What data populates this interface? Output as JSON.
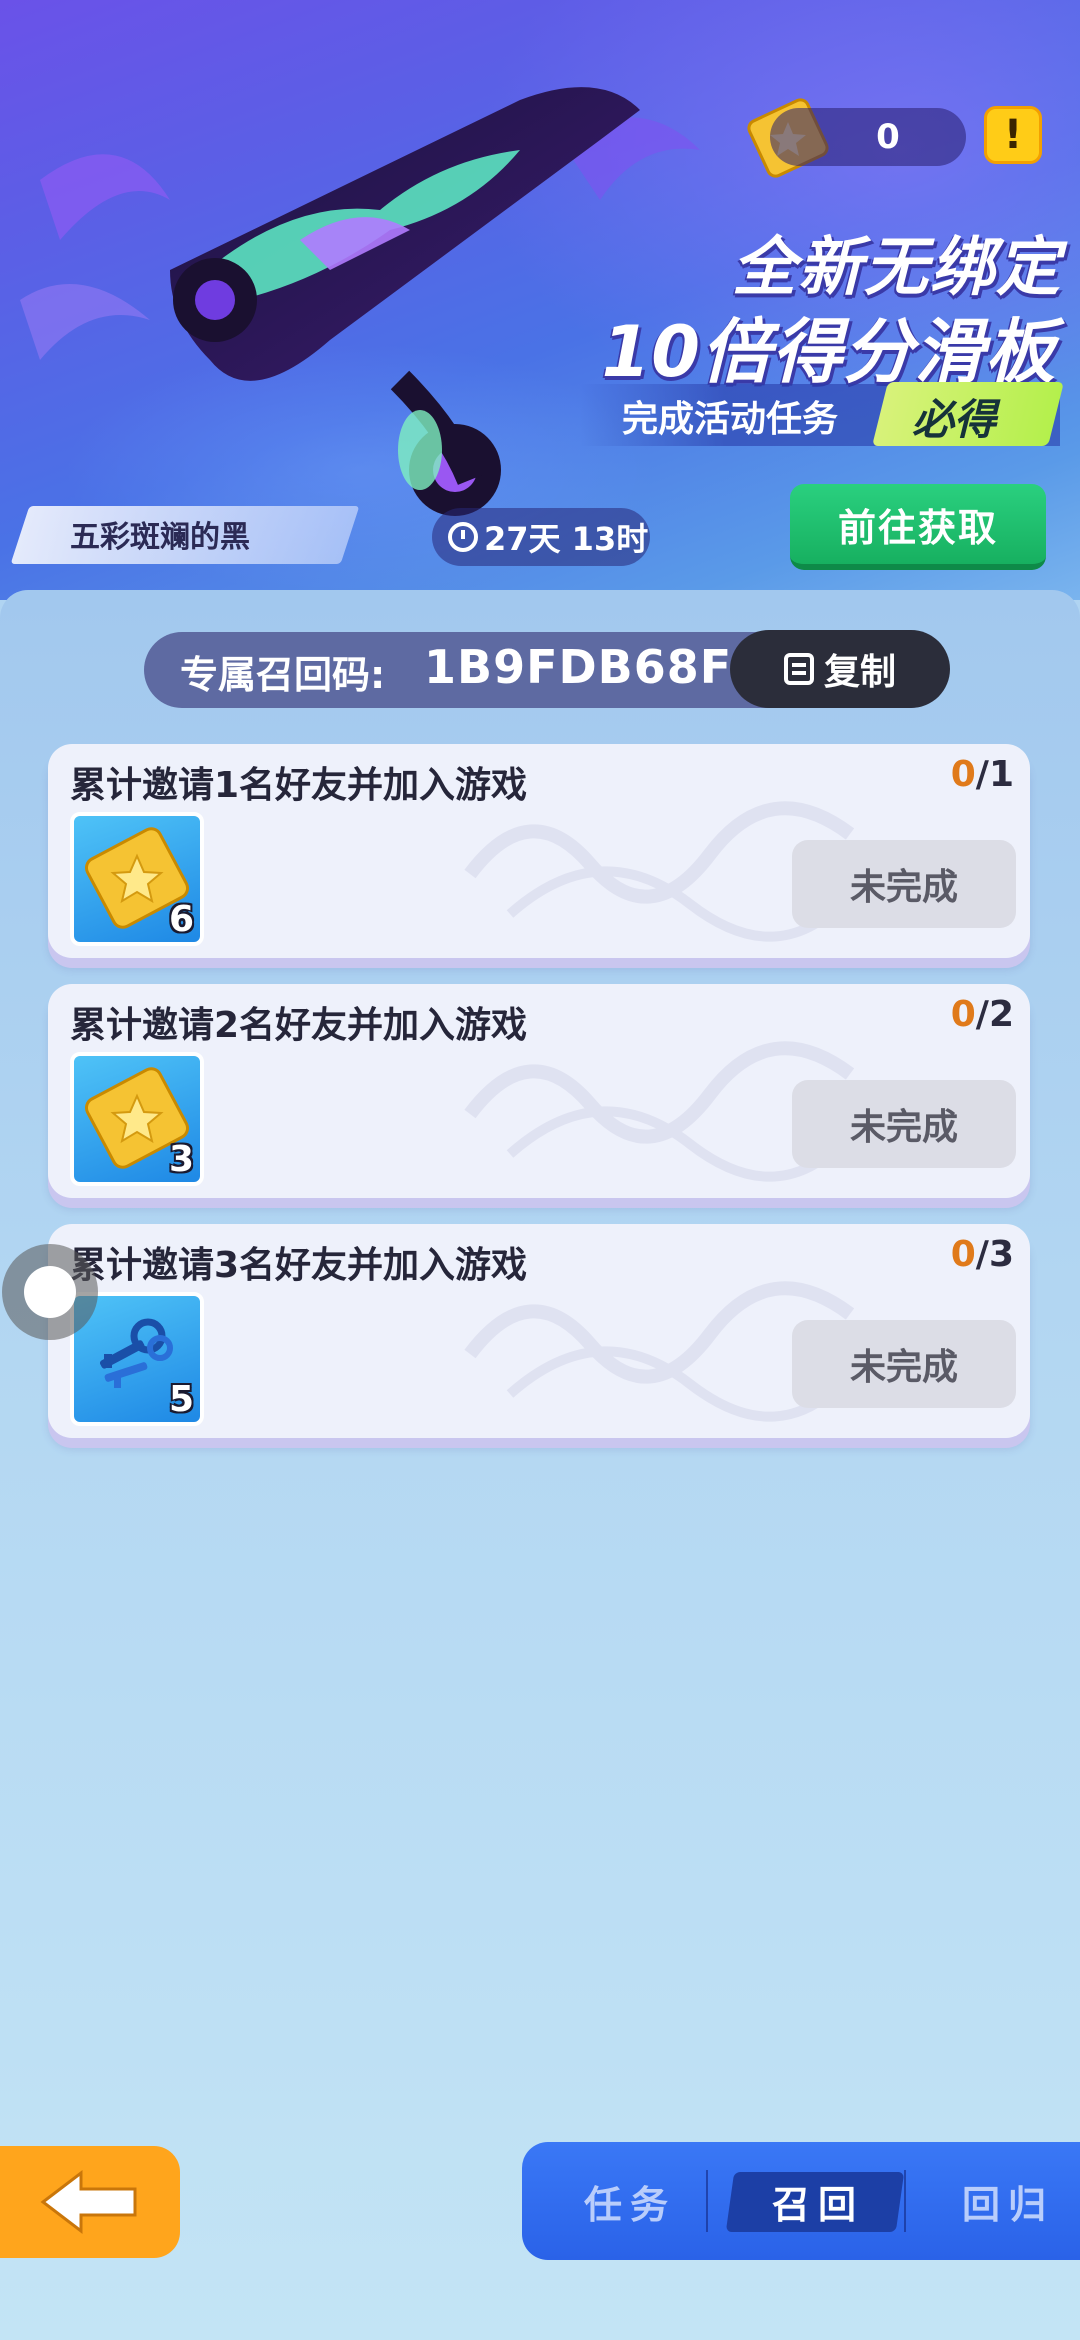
{
  "banner": {
    "currency_count": "0",
    "info_label": "!",
    "headline_line1": "全新无绑定",
    "headline_line2": "10倍得分滑板",
    "subtitle": "完成活动任务",
    "must_get": "必得",
    "skin_name": "五彩斑斓的黑",
    "countdown": "27天 13时",
    "goto_button": "前往获取"
  },
  "recall": {
    "label": "专属召回码:",
    "code": "1B9FDB68F",
    "copy_button": "复制"
  },
  "tasks": [
    {
      "title": "累计邀请1名好友并加入游戏",
      "progress_done": "0",
      "progress_total": "/1",
      "reward_icon": "gold-ticket-icon",
      "reward_count": "6",
      "status": "未完成"
    },
    {
      "title": "累计邀请2名好友并加入游戏",
      "progress_done": "0",
      "progress_total": "/2",
      "reward_icon": "gold-ticket-icon",
      "reward_count": "3",
      "status": "未完成"
    },
    {
      "title": "累计邀请3名好友并加入游戏",
      "progress_done": "0",
      "progress_total": "/3",
      "reward_icon": "key-bundle-icon",
      "reward_count": "5",
      "status": "未完成"
    }
  ],
  "nav": {
    "back_icon": "back-arrow-icon",
    "tabs": [
      {
        "label": "任务",
        "active": false
      },
      {
        "label": "召回",
        "active": true
      },
      {
        "label": "回归",
        "active": false
      }
    ]
  },
  "colors": {
    "accent_green": "#17b060",
    "progress_orange": "#e07a1a",
    "tab_blue": "#2a62e8",
    "back_orange": "#ffa51c",
    "ticket_gold": "#f5c333"
  }
}
